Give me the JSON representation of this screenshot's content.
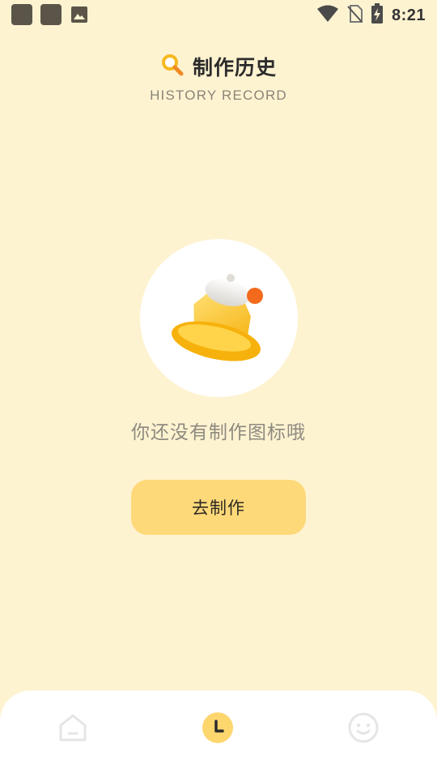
{
  "status_bar": {
    "time": "8:21",
    "icons": [
      "app-notification-icon",
      "app-notification-icon",
      "image-icon",
      "wifi-icon",
      "no-sim-icon",
      "battery-charging-icon"
    ]
  },
  "header": {
    "title": "制作历史",
    "subtitle": "HISTORY RECORD",
    "icon": "magnifier-icon"
  },
  "empty_state": {
    "illustration": "bell-icon",
    "message": "你还没有制作图标哦",
    "button_label": "去制作"
  },
  "bottom_nav": {
    "items": [
      {
        "name": "home",
        "icon": "home-icon",
        "active": false
      },
      {
        "name": "history",
        "icon": "clock-icon",
        "active": true
      },
      {
        "name": "profile",
        "icon": "smiley-icon",
        "active": false
      }
    ]
  },
  "colors": {
    "background": "#FEF3D1",
    "accent": "#FED97A",
    "active_nav": "#FDD66E",
    "inactive_nav": "#E6E6E6"
  }
}
